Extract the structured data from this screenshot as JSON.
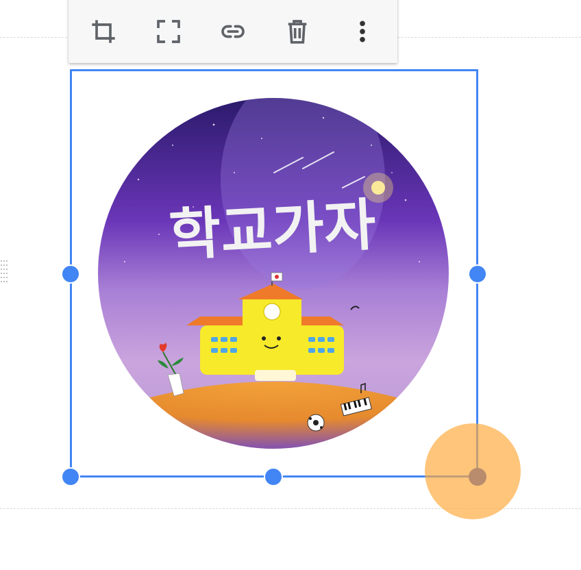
{
  "toolbar": {
    "items": [
      {
        "name": "crop",
        "icon": "crop-icon"
      },
      {
        "name": "fullscreen",
        "icon": "fullscreen-icon"
      },
      {
        "name": "link",
        "icon": "link-icon"
      },
      {
        "name": "delete",
        "icon": "trash-icon"
      },
      {
        "name": "more",
        "icon": "more-vertical-icon"
      }
    ]
  },
  "image": {
    "title_text": "학교가자",
    "flag_icon": "korean-flag-icon"
  },
  "colors": {
    "accent": "#4285f4",
    "toolbar_icon": "#5f6368",
    "touch_indicator": "#ffaa3c"
  }
}
